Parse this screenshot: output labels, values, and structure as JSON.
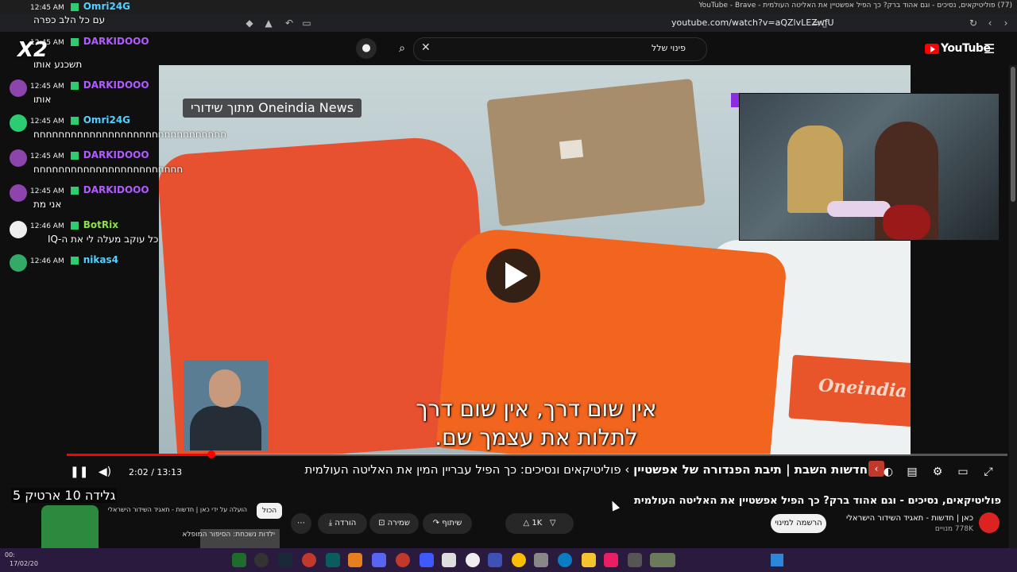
{
  "window": {
    "title": "(77) פוליטיקאים, נסיכים - וגם אהוד ברק? כך הפיל אפשטיין את האליטה העולמית - YouTube - Brave",
    "url": "youtube.com/watch?v=aQZlvLEZwfU"
  },
  "header": {
    "search_value": "פינוי שלל",
    "logo_text": "YouTube"
  },
  "video": {
    "news_tag": "מתוך שידורי Oneindia News",
    "watermark": "Oneindia",
    "subtitle_line1": "אין שום דרך, אין שום דרך",
    "subtitle_line2": "לתלות את עצמך שם."
  },
  "controls": {
    "time": "2:02 / 13:13",
    "chapter_bold": "חדשות השבת | תיבת הפנדורה של אפשטיין",
    "chapter_sep": " › ",
    "chapter_rest": "פוליטיקאים ונסיכים: כך הפיל עבריין המין את האליטה העולמית",
    "progress_fraction": 0.154
  },
  "below": {
    "title": "פוליטיקאים, נסיכים - וגם אהוד ברק? כך הפיל אפשטיין את האליטה העולמית",
    "channel": "כאן | חדשות - תאגיד השידור הישראלי",
    "subscribers": "778K מנויים",
    "subscribe": "הרשמה למינוי",
    "likes": "1K",
    "share": "שיתוף",
    "save": "שמירה",
    "download": "הורדה",
    "uploader_note": "הועלה על ידי כאן | חדשות - תאגיד השידור הישראלי",
    "all_chip": "הכול",
    "rec_title": "ילדות נשכחת: הסיפור המופלא"
  },
  "chat": {
    "x2": "X2",
    "messages": [
      {
        "time": "12:45 AM",
        "user": "Omri24G",
        "color": "#54d0ff",
        "text": "עם כל הלב כפרה"
      },
      {
        "time": "12:45 AM",
        "user": "DARKIDOOO",
        "color": "#b15cff",
        "text": "תשכנע אותו"
      },
      {
        "time": "12:45 AM",
        "user": "DARKIDOOO",
        "color": "#b15cff",
        "text": "אותו"
      },
      {
        "time": "12:45 AM",
        "user": "Omri24G",
        "color": "#54d0ff",
        "text": "חחחחחחחחחחחחחחחחחחחחחחחחחחחחחחח"
      },
      {
        "time": "12:45 AM",
        "user": "DARKIDOOO",
        "color": "#b15cff",
        "text": "חחחחחחחחחחחחחחחחחחחחחחחח"
      },
      {
        "time": "12:45 AM",
        "user": "DARKIDOOO",
        "color": "#b15cff",
        "text": "אני מת"
      },
      {
        "time": "12:46 AM",
        "user": "BotRix",
        "color": "#8ee04a",
        "text": "כל עוקב מעלה לי את ה-IQ"
      },
      {
        "time": "12:46 AM",
        "user": "nikas4",
        "color": "#54d0ff",
        "text": ""
      }
    ]
  },
  "overlay": {
    "goal": "גלידה 10 ארטיק 5"
  },
  "taskbar": {
    "time": "00:",
    "date": "17/02/20"
  }
}
